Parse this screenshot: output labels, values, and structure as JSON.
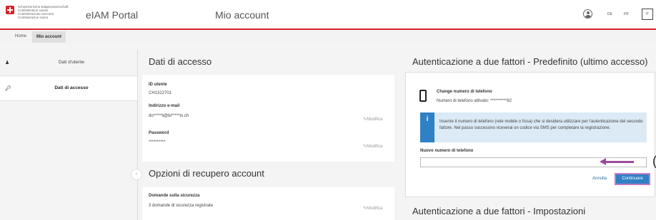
{
  "header": {
    "confederation": "Schweizerische Eidgenossenschaft\nConfédération suisse\nConfederazione Svizzera\nConfederaziun svizra",
    "app_title": "eIAM Portal",
    "page_title": "Mio account",
    "languages": [
      "DE",
      "FR",
      "IT"
    ],
    "active_language": "IT"
  },
  "tabs": [
    "Home",
    "Mio account"
  ],
  "sidebar": {
    "items": [
      {
        "label": "Dati d'utente",
        "icon": "user-icon"
      },
      {
        "label": "Dati di accesso",
        "icon": "key-icon"
      }
    ]
  },
  "access": {
    "title": "Dati di accesso",
    "user_id_label": "ID utente",
    "user_id": "CH1312701",
    "email_label": "Indirizzo e-mail",
    "email": "do*****li@bi*****in.ch",
    "password_label": "Password",
    "password": "**********",
    "edit_label": "Modifica"
  },
  "recovery": {
    "title": "Opzioni di recupero account",
    "security_label": "Domande sulla sicurezza",
    "security_value": "3 domande di sicurezza registrate",
    "edit_label": "Modifica"
  },
  "twofa": {
    "title": "Autenticazione a due fattori - Predefinito (ultimo accesso)",
    "change_title": "Change numero di telefono",
    "current_number": "Numero di telefono attivato: **********82",
    "info_text": "Inserire il numero di telefono (rete mobile o fissa) che si desidera utilizzare per l'autenticazione del secondo fattore. Nel passo successivo riceverai un codice via SMS per completare la registrazione.",
    "new_number_label": "Nuovo numero di telefono",
    "new_number_value": "",
    "cancel_label": "Annulla",
    "continue_label": "Continuare",
    "settings_title": "Autenticazione a due fattori - Impostazioni"
  }
}
